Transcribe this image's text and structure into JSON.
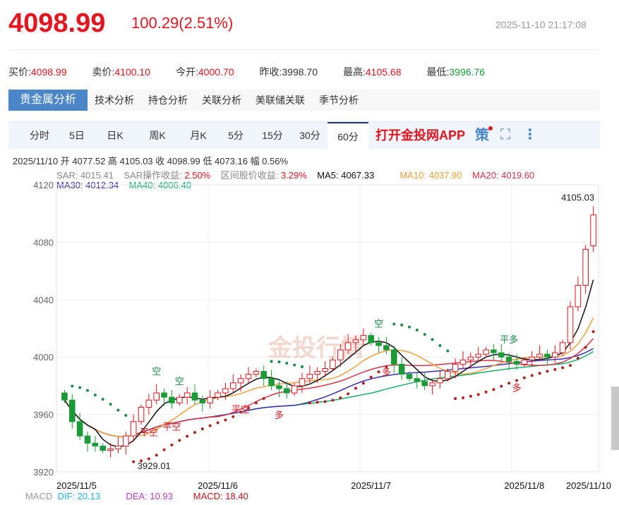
{
  "header": {
    "price": "4098.99",
    "change": "100.29(2.51%)",
    "time": "2025-11-10 21:17:08"
  },
  "quotes": [
    {
      "label": "买价:",
      "value": "4098.99",
      "color": "red"
    },
    {
      "label": "卖价:",
      "value": "4100.10",
      "color": "red"
    },
    {
      "label": "今开:",
      "value": "4000.70",
      "color": "red"
    },
    {
      "label": "昨收:",
      "value": "3998.70",
      "color": ""
    },
    {
      "label": "最高:",
      "value": "4105.68",
      "color": "red"
    },
    {
      "label": "最低:",
      "value": "3996.76",
      "color": "green"
    }
  ],
  "analysis_tabs": [
    "贵金属分析",
    "技术分析",
    "持仓分析",
    "关联分析",
    "美联储关联",
    "季节分析"
  ],
  "period_tabs": [
    "分时",
    "5日",
    "日K",
    "周K",
    "月K",
    "5分",
    "15分",
    "30分",
    "60分"
  ],
  "app_link": "打开金投网APP",
  "strategy_icon": "策",
  "info": "2025/11/10 开 4077.52 高 4105.03 收 4098.99 低 4073.16 幅 0.56%",
  "legend": {
    "sar": "SAR: 4015.41",
    "sar_profit_label": "SAR操作收益: ",
    "sar_profit": "2.50%",
    "range_label": "区间股价收益: ",
    "range": "3.29%",
    "ma5": "MA5: 4067.33",
    "ma10": "MA10: 4037.90",
    "ma20": "MA20: 4019.60",
    "ma30": "MA30: 4012.34",
    "ma40": "MA40: 4006.40"
  },
  "macd": {
    "label": "MACD",
    "dif": "DIF: 20.13",
    "dea": "DEA: 10.93",
    "macd": "MACD: 18.40"
  },
  "chart_data": {
    "type": "candlestick",
    "ylim": [
      3920,
      4120
    ],
    "yticks": [
      "4120",
      "4080",
      "4040",
      "4000",
      "3960",
      "3920"
    ],
    "xlabels": [
      {
        "label": "2025/11/5",
        "i": 0
      },
      {
        "label": "2025/11/6",
        "i": 20
      },
      {
        "label": "2025/11/7",
        "i": 40
      },
      {
        "label": "2025/11/8",
        "i": 60
      },
      {
        "label": "2025/11/10",
        "i": 67
      }
    ],
    "max_label": "4105.03",
    "min_label": "3929.01",
    "signals": [
      {
        "text": "空",
        "i": 12,
        "type": "short"
      },
      {
        "text": "空",
        "i": 15,
        "type": "short"
      },
      {
        "text": "平空",
        "i": 11,
        "type": "cover"
      },
      {
        "text": "平空",
        "i": 14,
        "type": "cover"
      },
      {
        "text": "平空",
        "i": 23,
        "type": "cover"
      },
      {
        "text": "多",
        "i": 28,
        "type": "long"
      },
      {
        "text": "空",
        "i": 41,
        "type": "short"
      },
      {
        "text": "多",
        "i": 42,
        "type": "long"
      },
      {
        "text": "平多",
        "i": 58,
        "type": "short"
      },
      {
        "text": "多",
        "i": 59,
        "type": "long"
      }
    ],
    "closes": [
      3970,
      3955,
      3945,
      3940,
      3938,
      3935,
      3936,
      3938,
      3945,
      3955,
      3965,
      3970,
      3975,
      3972,
      3968,
      3972,
      3975,
      3970,
      3968,
      3972,
      3975,
      3978,
      3982,
      3985,
      3988,
      3990,
      3985,
      3980,
      3978,
      3975,
      3980,
      3985,
      3988,
      3990,
      3992,
      3998,
      4005,
      4010,
      4012,
      4015,
      4010,
      4008,
      4005,
      3995,
      3988,
      3985,
      3983,
      3980,
      3982,
      3985,
      3990,
      3995,
      3998,
      4000,
      4002,
      4005,
      4003,
      4000,
      3997,
      3995,
      3998,
      4000,
      4002,
      4000,
      4003,
      4010,
      4035,
      4050,
      4075,
      4098.99
    ],
    "first_open": 3975,
    "last": {
      "open": 4077.52,
      "high": 4105.03,
      "low": 4073.16
    }
  }
}
